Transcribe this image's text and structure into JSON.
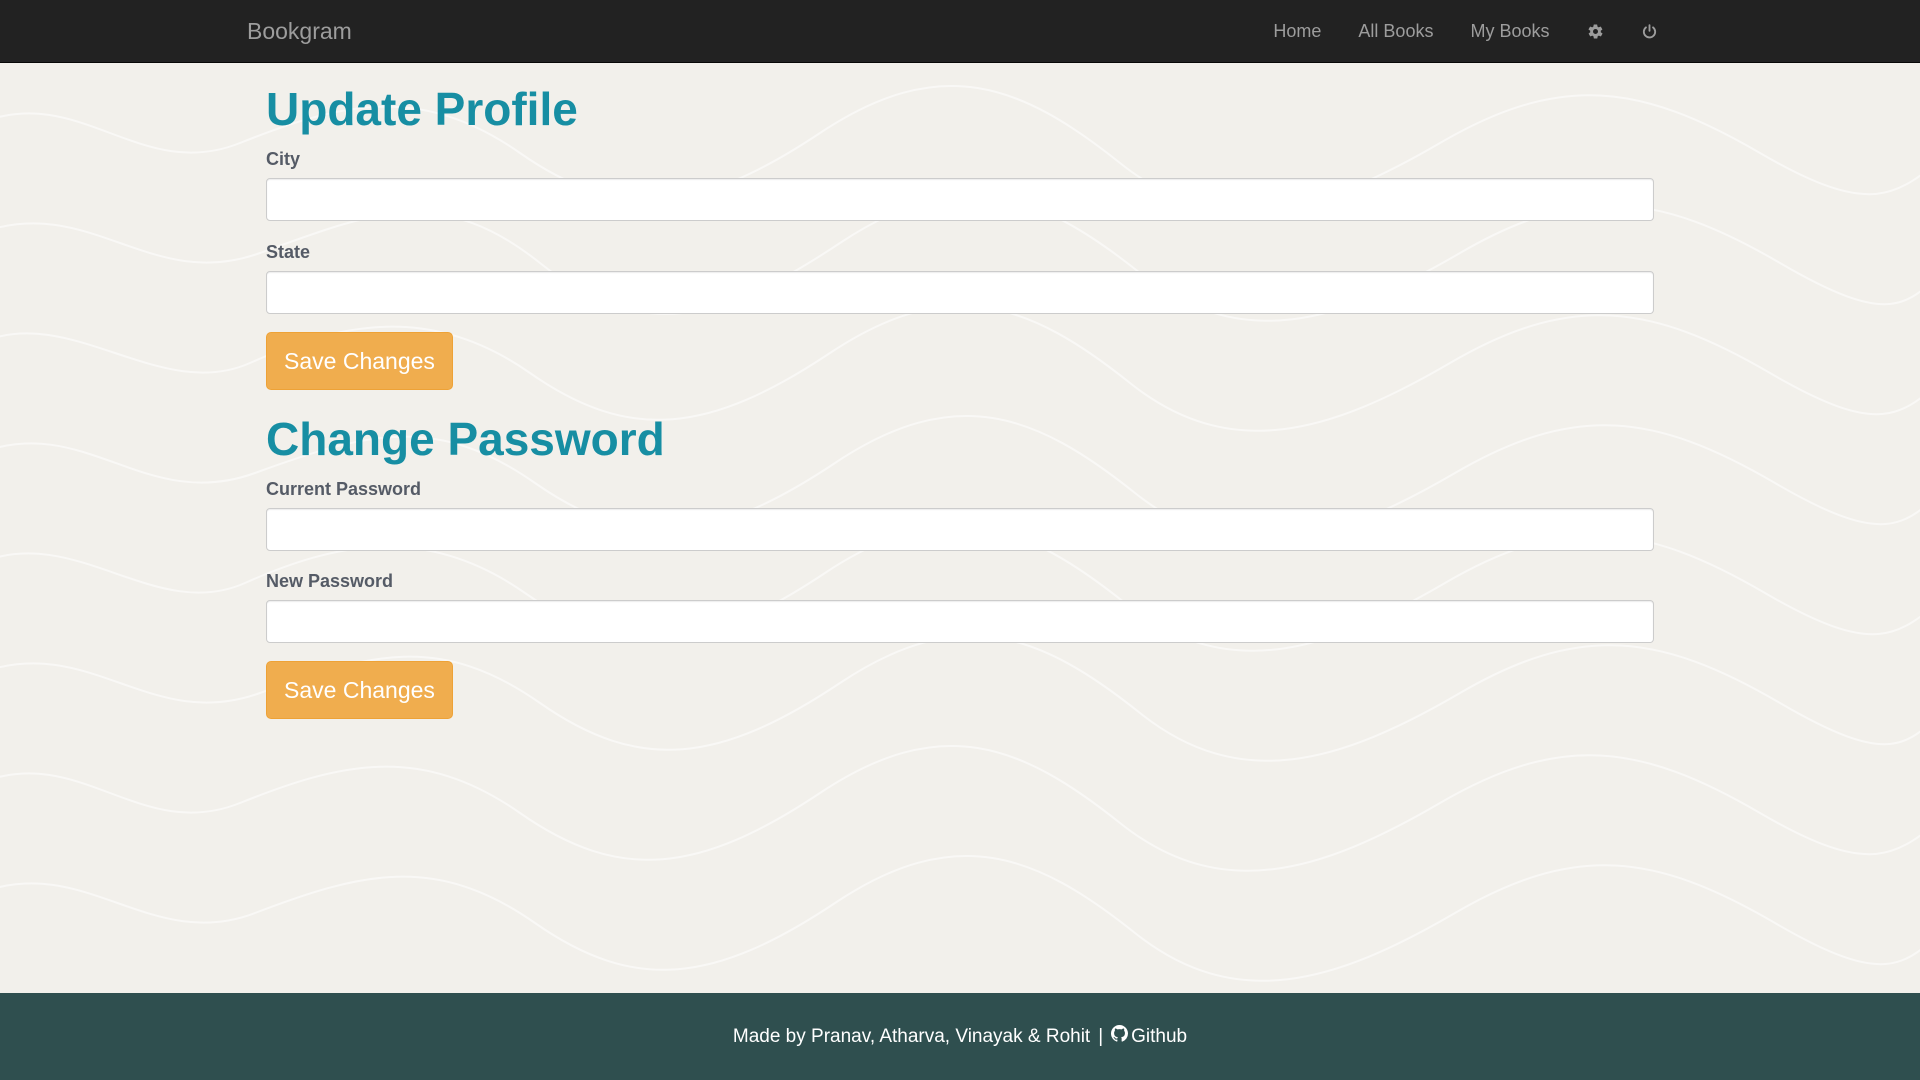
{
  "navbar": {
    "brand": "Bookgram",
    "links": [
      "Home",
      "All Books",
      "My Books"
    ],
    "icons": [
      "gear-icon",
      "power-icon"
    ]
  },
  "update_profile": {
    "heading": "Update Profile",
    "city_label": "City",
    "city_value": "",
    "state_label": "State",
    "state_value": "",
    "save_label": "Save Changes"
  },
  "change_password": {
    "heading": "Change Password",
    "current_label": "Current Password",
    "current_value": "",
    "new_label": "New Password",
    "new_value": "",
    "save_label": "Save Changes"
  },
  "footer": {
    "credits": "Made by Pranav, Atharva, Vinayak & Rohit",
    "separator": "|",
    "github_label": "Github",
    "github_icon": "github-icon"
  },
  "colors": {
    "navbar_bg": "#222222",
    "heading": "#178ea3",
    "button": "#f0ad4e",
    "footer_bg": "#2f4f4f",
    "page_bg": "#f2f0eb"
  }
}
